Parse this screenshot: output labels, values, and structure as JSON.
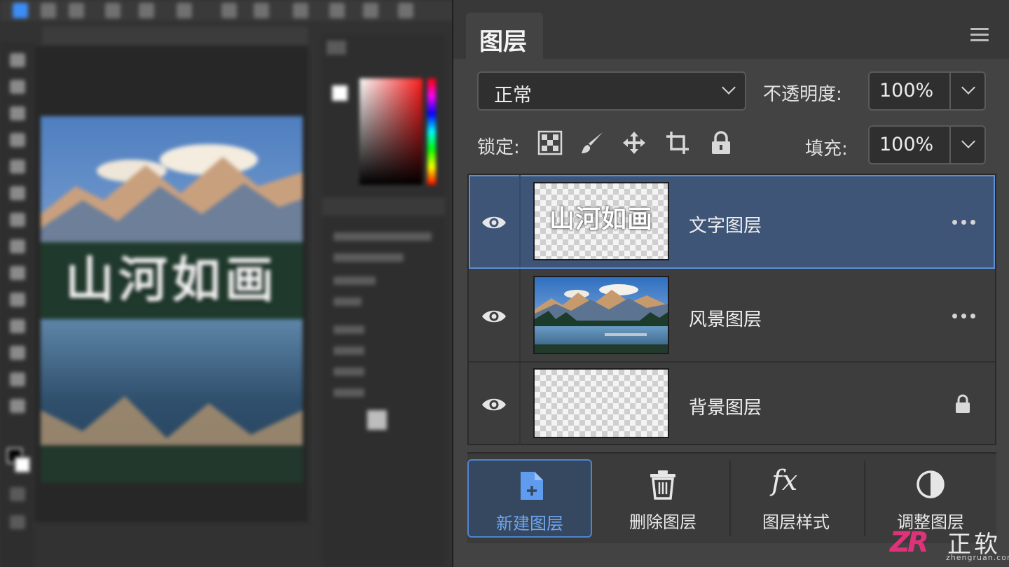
{
  "workspace": {
    "canvas_title": "山河如画"
  },
  "layers_panel": {
    "tab_label": "图层",
    "blend_mode": "正常",
    "opacity_label": "不透明度:",
    "opacity_value": "100%",
    "lock_label": "锁定:",
    "fill_label": "填充:",
    "fill_value": "100%",
    "layers": [
      {
        "name": "文字图层",
        "thumb_text": "山河如画",
        "selected": true,
        "locked": false
      },
      {
        "name": "风景图层",
        "selected": false,
        "locked": false
      },
      {
        "name": "背景图层",
        "selected": false,
        "locked": true
      }
    ],
    "bottom_buttons": [
      {
        "label": "新建图层",
        "icon": "new-layer-icon",
        "active": true
      },
      {
        "label": "删除图层",
        "icon": "trash-icon",
        "active": false
      },
      {
        "label": "图层样式",
        "icon": "fx-icon",
        "icon_text": "fx",
        "active": false
      },
      {
        "label": "调整图层",
        "icon": "half-circle-icon",
        "active": false
      }
    ]
  },
  "watermark": {
    "logo": "ZR",
    "name": "正软",
    "url": "zhengruan.com"
  },
  "colors": {
    "accent": "#5b8fd6",
    "selected_row": "#3e5577",
    "active_label": "#6ea6f0",
    "panel_bg": "#434343"
  }
}
